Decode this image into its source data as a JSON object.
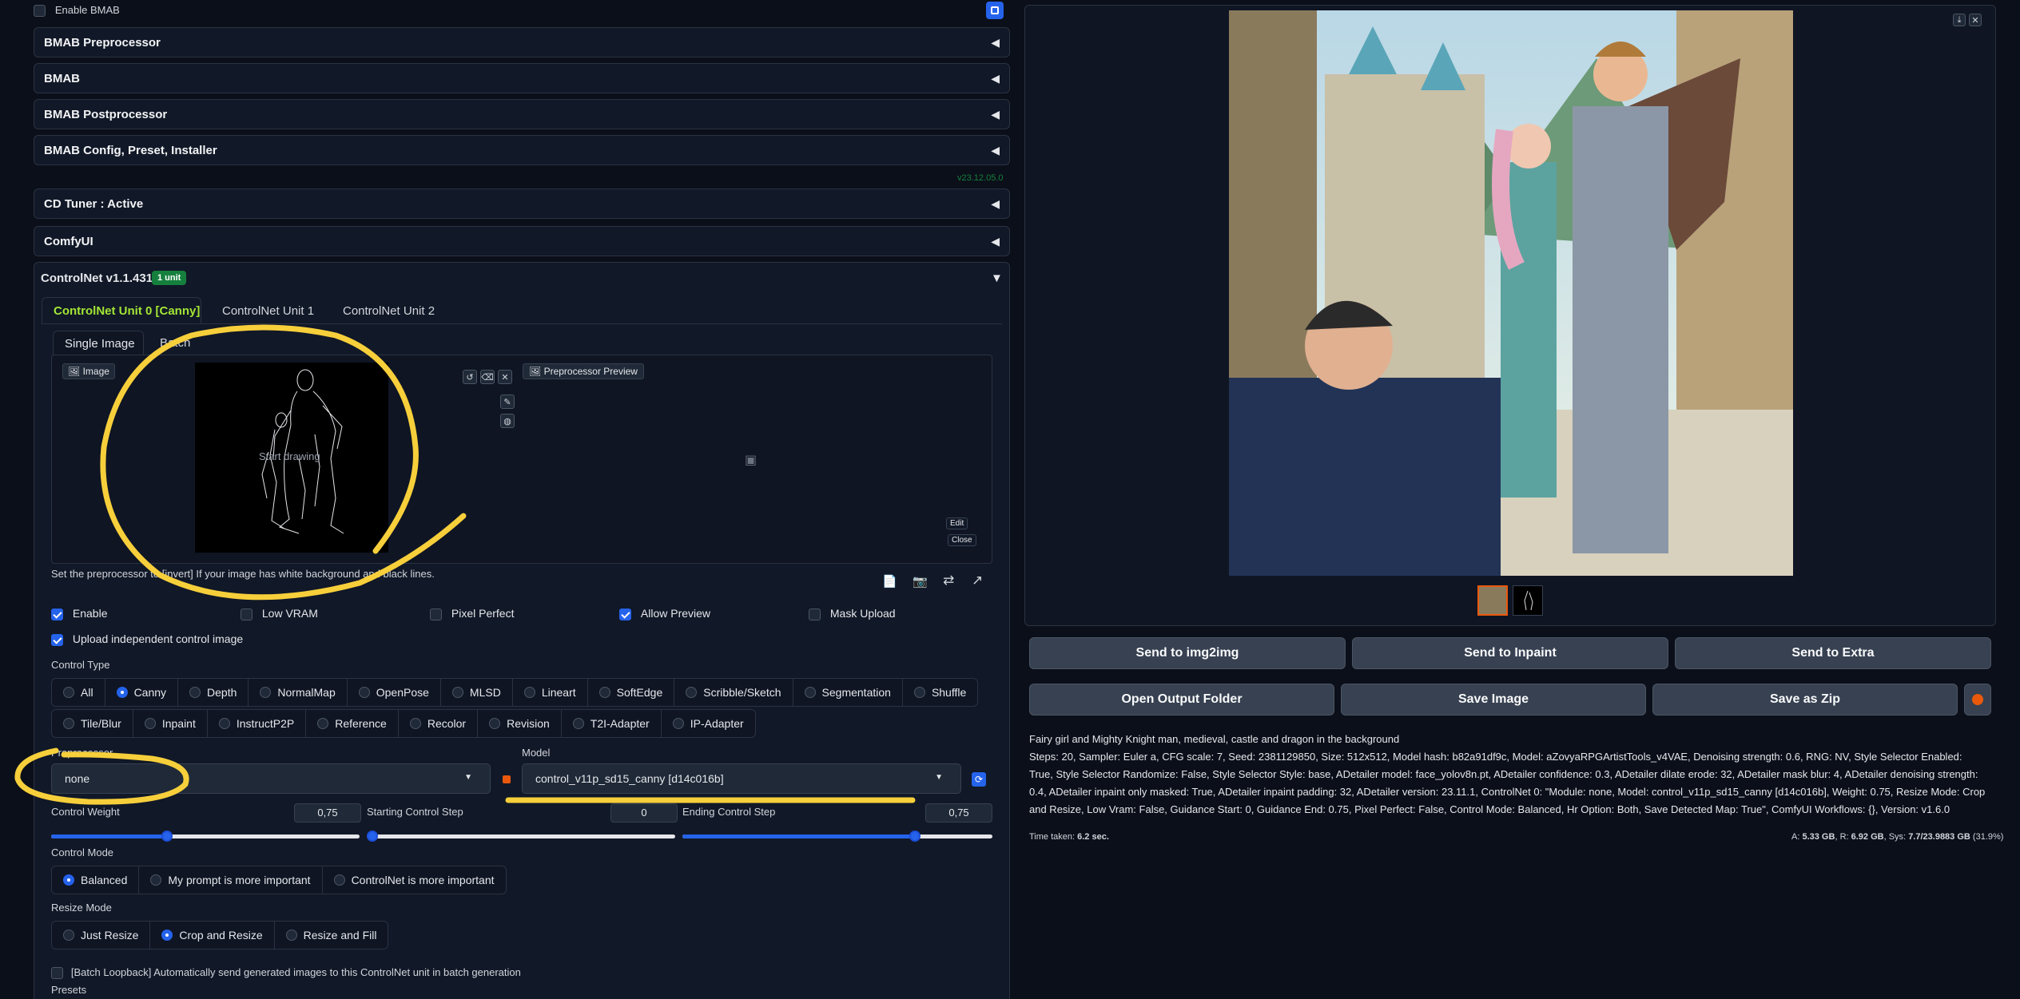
{
  "accordions": {
    "enable_bmab": "Enable BMAB",
    "bmab_preprocessor": "BMAB Preprocessor",
    "bmab": "BMAB",
    "bmab_postprocessor": "BMAB Postprocessor",
    "bmab_config": "BMAB Config, Preset, Installer",
    "version_tag": "v23.12.05.0",
    "cd_tuner": "CD Tuner : Active",
    "comfyui": "ComfyUI",
    "controlnet": "ControlNet v1.1.431",
    "controlnet_badge": "1 unit"
  },
  "unit_tabs": [
    "ControlNet Unit 0 [Canny]",
    "ControlNet Unit 1",
    "ControlNet Unit 2"
  ],
  "image_tabs": [
    "Single Image",
    "Batch"
  ],
  "image_panel": {
    "image_label": "Image",
    "canvas_text": "Start drawing",
    "preview_label": "Preprocessor Preview",
    "edit": "Edit",
    "close": "Close"
  },
  "hint_text": "Set the preprocessor to [invert] If your image has white background and black lines.",
  "checkboxes": {
    "enable": "Enable",
    "low_vram": "Low VRAM",
    "pixel_perfect": "Pixel Perfect",
    "allow_preview": "Allow Preview",
    "mask_upload": "Mask Upload",
    "upload_independent": "Upload independent control image"
  },
  "control_type": {
    "label": "Control Type",
    "row1": [
      "All",
      "Canny",
      "Depth",
      "NormalMap",
      "OpenPose",
      "MLSD",
      "Lineart",
      "SoftEdge",
      "Scribble/Sketch",
      "Segmentation",
      "Shuffle"
    ],
    "row2": [
      "Tile/Blur",
      "Inpaint",
      "InstructP2P",
      "Reference",
      "Recolor",
      "Revision",
      "T2I-Adapter",
      "IP-Adapter"
    ],
    "selected": "Canny"
  },
  "preprocessor": {
    "label": "Preprocessor",
    "value": "none"
  },
  "model": {
    "label": "Model",
    "value": "control_v11p_sd15_canny [d14c016b]"
  },
  "sliders": {
    "weight_label": "Control Weight",
    "weight_value": "0,75",
    "weight_fraction": 0.375,
    "start_label": "Starting Control Step",
    "start_value": "0",
    "start_fraction": 0.0,
    "end_label": "Ending Control Step",
    "end_value": "0,75",
    "end_fraction": 0.75
  },
  "control_mode": {
    "label": "Control Mode",
    "options": [
      "Balanced",
      "My prompt is more important",
      "ControlNet is more important"
    ],
    "selected": "Balanced"
  },
  "resize_mode": {
    "label": "Resize Mode",
    "options": [
      "Just Resize",
      "Crop and Resize",
      "Resize and Fill"
    ],
    "selected": "Crop and Resize"
  },
  "batch_loopback": "[Batch Loopback] Automatically send generated images to this ControlNet unit in batch generation",
  "presets": "Presets",
  "output": {
    "buttons_row1": [
      "Send to img2img",
      "Send to Inpaint",
      "Send to Extra"
    ],
    "buttons_row2": [
      "Open Output Folder",
      "Save Image",
      "Save as Zip"
    ],
    "prompt": "Fairy girl and Mighty Knight man, medieval, castle and dragon in the background",
    "params": "Steps: 20, Sampler: Euler a, CFG scale: 7, Seed: 2381129850, Size: 512x512, Model hash: b82a91df9c, Model: aZovyaRPGArtistTools_v4VAE, Denoising strength: 0.6, RNG: NV, Style Selector Enabled: True, Style Selector Randomize: False, Style Selector Style: base, ADetailer model: face_yolov8n.pt, ADetailer confidence: 0.3, ADetailer dilate erode: 32, ADetailer mask blur: 4, ADetailer denoising strength: 0.4, ADetailer inpaint only masked: True, ADetailer inpaint padding: 32, ADetailer version: 23.11.1, ControlNet 0: \"Module: none, Model: control_v11p_sd15_canny [d14c016b], Weight: 0.75, Resize Mode: Crop and Resize, Low Vram: False, Guidance Start: 0, Guidance End: 0.75, Pixel Perfect: False, Control Mode: Balanced, Hr Option: Both, Save Detected Map: True\", ComfyUI Workflows: {}, Version: v1.6.0",
    "time_label": "Time taken:",
    "time_value": "6.2 sec.",
    "mem_a_label": "A:",
    "mem_a": "5.33 GB",
    "mem_r_label": "R:",
    "mem_r": "6.92 GB",
    "mem_sys_label": "Sys:",
    "mem_sys": "7.7/23.9883 GB",
    "mem_pct": "(31.9%)"
  },
  "colors": {
    "accent": "#2563eb",
    "highlight": "#f7cf3b",
    "active_tab": "#a3e635",
    "badge": "#15803d"
  }
}
